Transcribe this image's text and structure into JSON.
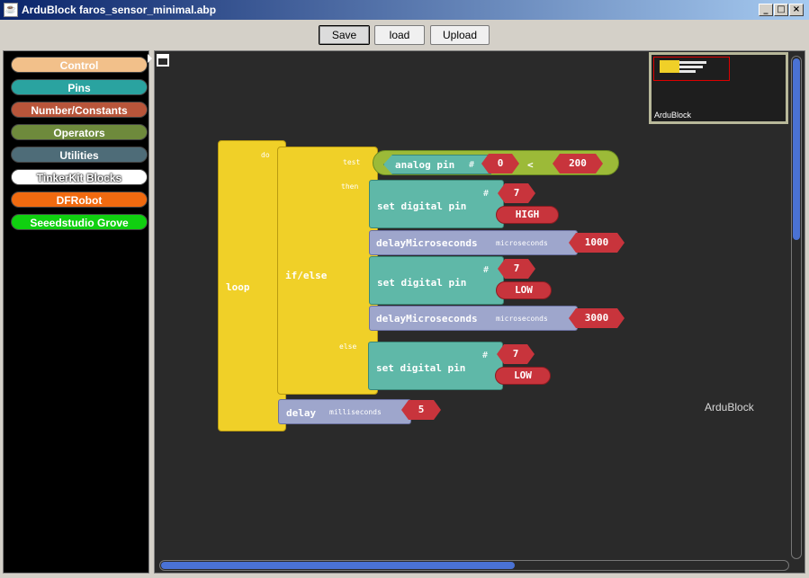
{
  "window": {
    "title": "ArduBlock faros_sensor_minimal.abp"
  },
  "toolbar": {
    "save": "Save",
    "load": "load",
    "upload": "Upload"
  },
  "categories": [
    {
      "label": "Control",
      "color": "#f2c08a"
    },
    {
      "label": "Pins",
      "color": "#2aa3a0"
    },
    {
      "label": "Number/Constants",
      "color": "#b8553a"
    },
    {
      "label": "Operators",
      "color": "#6e8a3c"
    },
    {
      "label": "Utilities",
      "color": "#4e6c78"
    },
    {
      "label": "TinkerKit Blocks",
      "color": "#ffffff"
    },
    {
      "label": "DFRobot",
      "color": "#f06a10"
    },
    {
      "label": "Seeedstudio Grove",
      "color": "#10d010"
    }
  ],
  "minimap": {
    "label": "ArduBlock"
  },
  "watermark": "ArduBlock",
  "blocks": {
    "loop": {
      "label": "loop",
      "do": "do"
    },
    "ifelse": {
      "label": "if/else",
      "test": "test",
      "then": "then",
      "else": "else"
    },
    "analog": {
      "label": "analog pin",
      "hash": "#",
      "pin": "0",
      "op": "<",
      "value": "200"
    },
    "set1": {
      "label": "set digital pin",
      "hash": "#",
      "pin": "7",
      "state": "HIGH"
    },
    "delay1": {
      "label": "delayMicroseconds",
      "socket": "microseconds",
      "value": "1000"
    },
    "set2": {
      "label": "set digital pin",
      "hash": "#",
      "pin": "7",
      "state": "LOW"
    },
    "delay2": {
      "label": "delayMicroseconds",
      "socket": "microseconds",
      "value": "3000"
    },
    "set3": {
      "label": "set digital pin",
      "hash": "#",
      "pin": "7",
      "state": "LOW"
    },
    "delay3": {
      "label": "delay",
      "socket": "milliseconds",
      "value": "5"
    }
  }
}
